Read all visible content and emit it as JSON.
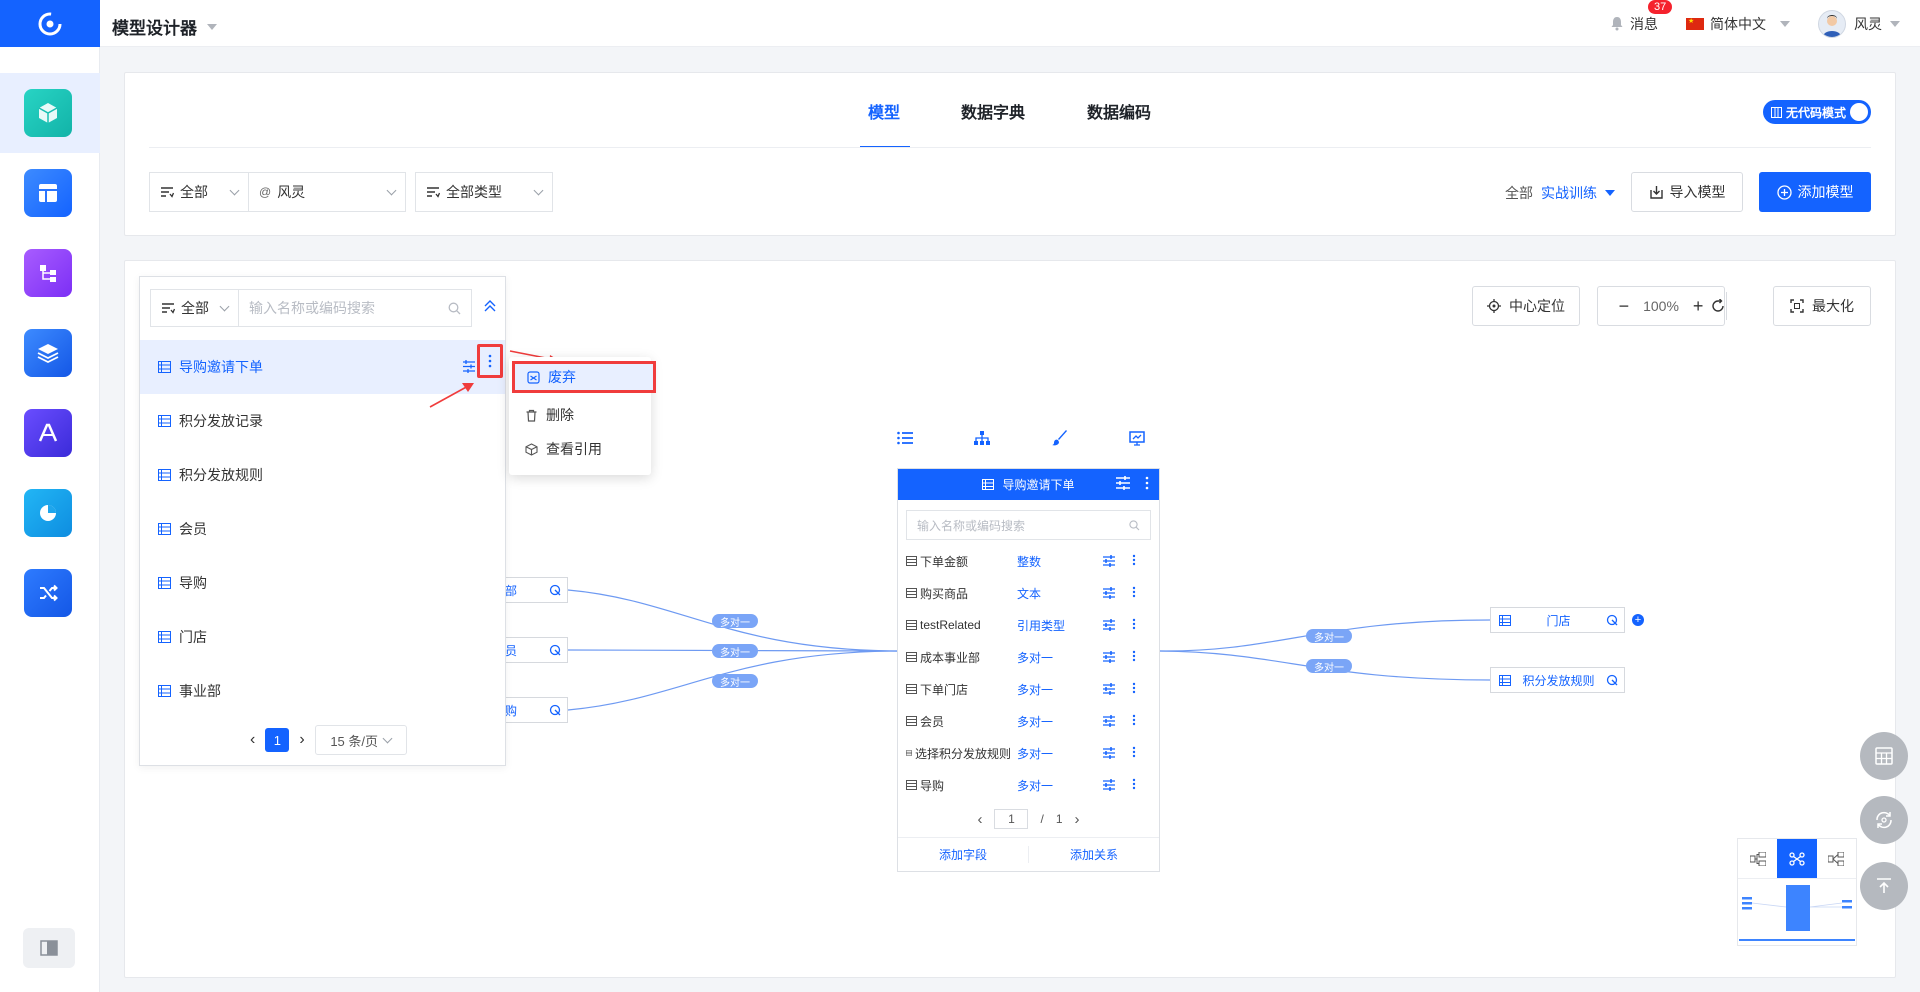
{
  "app": {
    "title": "模型设计器"
  },
  "topbar": {
    "messages_label": "消息",
    "messages_count": "37",
    "language": "简体中文",
    "user_name": "风灵"
  },
  "tabs": [
    {
      "label": "模型"
    },
    {
      "label": "数据字典"
    },
    {
      "label": "数据编码"
    }
  ],
  "nocode_toggle": {
    "label": "无代码模式"
  },
  "filters": {
    "scope": "全部",
    "owner": "风灵",
    "type": "全部类型"
  },
  "scope_switch": {
    "prefix": "全部",
    "value": "实战训练"
  },
  "buttons": {
    "import": "导入模型",
    "add": "添加模型"
  },
  "list_panel": {
    "filter": "全部",
    "search_placeholder": "输入名称或编码搜索",
    "items": [
      "导购邀请下单",
      "积分发放记录",
      "积分发放规则",
      "会员",
      "导购",
      "门店",
      "事业部"
    ],
    "page": "1",
    "page_size": "15 条/页"
  },
  "context_menu": {
    "items": [
      "废弃",
      "删除",
      "查看引用"
    ]
  },
  "canvas_controls": {
    "center": "中心定位",
    "zoom": "100%",
    "maximize": "最大化"
  },
  "entity": {
    "title": "导购邀请下单",
    "search_placeholder": "输入名称或编码搜索",
    "fields": [
      {
        "name": "下单金额",
        "type": "整数"
      },
      {
        "name": "购买商品",
        "type": "文本"
      },
      {
        "name": "testRelated",
        "type": "引用类型"
      },
      {
        "name": "成本事业部",
        "type": "多对一"
      },
      {
        "name": "下单门店",
        "type": "多对一"
      },
      {
        "name": "会员",
        "type": "多对一"
      },
      {
        "name": "选择积分发放规则",
        "type": "多对一"
      },
      {
        "name": "导购",
        "type": "多对一"
      }
    ],
    "page_current": "1",
    "page_sep": "/",
    "page_total": "1",
    "add_field": "添加字段",
    "add_relation": "添加关系"
  },
  "left_nodes": [
    "部",
    "员",
    "购"
  ],
  "right_nodes": [
    "门店",
    "积分发放规则"
  ],
  "edge_label": "多对一"
}
